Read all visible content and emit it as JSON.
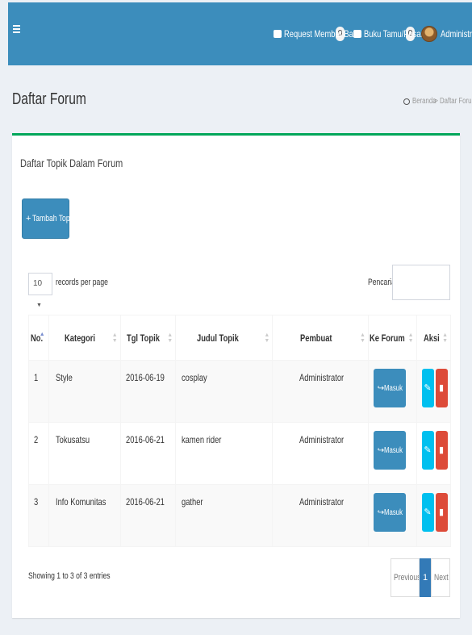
{
  "header": {
    "request_label": "Request Member Baru",
    "request_count": "0",
    "guestbook_label": "Buku Tamu/Pesan",
    "guestbook_count": "0",
    "user_name": "Administrator",
    "color": "#3c8dbc"
  },
  "page": {
    "title": "Daftar Forum",
    "breadcrumb": [
      "Beranda",
      ">",
      "Daftar Forum"
    ]
  },
  "box": {
    "title": "Daftar Topik Dalam Forum",
    "add_button": "Tambah Topik",
    "length_value": "10",
    "length_label": "records per page",
    "search_label": "Pencarian:",
    "accent_color": "#00a65a"
  },
  "table": {
    "headers": [
      "No.",
      "Kategori",
      "Tgl Topik",
      "Judul Topik",
      "Pembuat",
      "Ke Forum",
      "Aksi"
    ],
    "rows": [
      {
        "no": "1",
        "kategori": "Style",
        "tgl": "2016-06-19",
        "judul": "cosplay",
        "pembuat": "Administrator",
        "action": "Masuk"
      },
      {
        "no": "2",
        "kategori": "Tokusatsu",
        "tgl": "2016-06-21",
        "judul": "kamen rider",
        "pembuat": "Administrator",
        "action": "Masuk"
      },
      {
        "no": "3",
        "kategori": "Info Komunitas",
        "tgl": "2016-06-21",
        "judul": "gather",
        "pembuat": "Administrator",
        "action": "Masuk"
      }
    ]
  },
  "footer": {
    "info": "Showing 1 to 3 of 3 entries",
    "prev": "Previous",
    "page": "1",
    "next": "Next"
  }
}
